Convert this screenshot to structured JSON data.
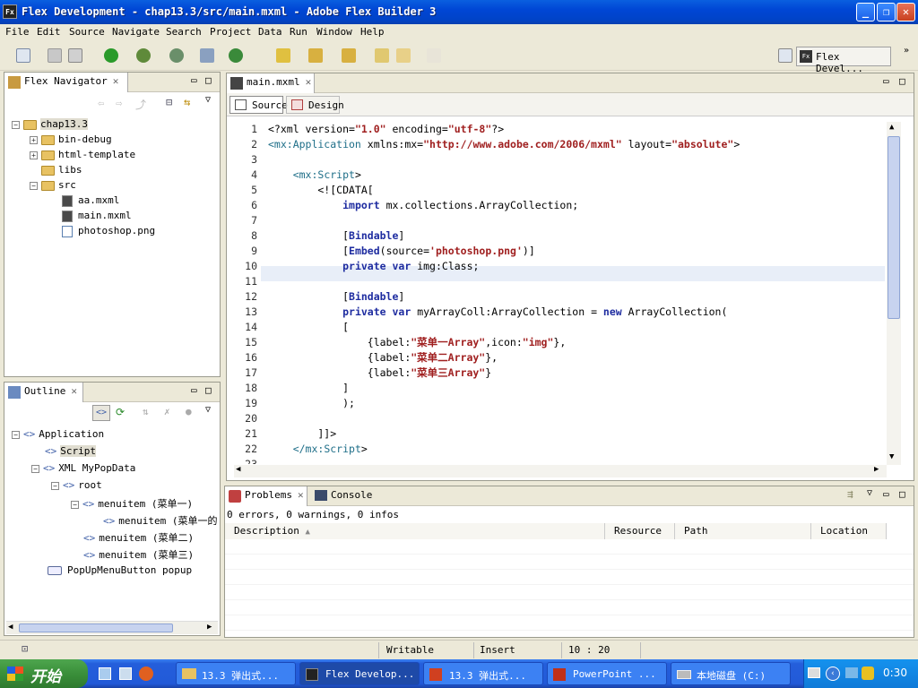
{
  "window": {
    "title": "Flex Development - chap13.3/src/main.mxml - Adobe Flex Builder 3",
    "app_icon": "Fx"
  },
  "menu": [
    "File",
    "Edit",
    "Source",
    "Navigate",
    "Search",
    "Project",
    "Data",
    "Run",
    "Window",
    "Help"
  ],
  "perspective": {
    "label": "Flex Devel...",
    "icon": "Fx"
  },
  "navigator": {
    "tab": "Flex Navigator",
    "project": "chap13.3",
    "items": [
      "bin-debug",
      "html-template",
      "libs",
      "src"
    ],
    "src_items": [
      "aa.mxml",
      "main.mxml",
      "photoshop.png"
    ]
  },
  "outline": {
    "tab": "Outline",
    "nodes": [
      "Application",
      "Script",
      "XML MyPopData",
      "root",
      "menuitem (菜单一)",
      "menuitem (菜单一的",
      "menuitem (菜单二)",
      "menuitem (菜单三)",
      "PopUpMenuButton popup"
    ]
  },
  "editor": {
    "tab": "main.mxml",
    "mode_source": "Source",
    "mode_design": "Design",
    "lines": [
      "<?xml version=\"1.0\" encoding=\"utf-8\"?>",
      "<mx:Application xmlns:mx=\"http://www.adobe.com/2006/mxml\" layout=\"absolute\">",
      "",
      "    <mx:Script>",
      "        <![CDATA[",
      "            import mx.collections.ArrayCollection;",
      "",
      "            [Bindable]",
      "            [Embed(source='photoshop.png')]",
      "            private var img:Class;",
      "",
      "            [Bindable]",
      "            private var myArrayColl:ArrayCollection = new ArrayCollection(",
      "            [",
      "                {label:\"菜单一Array\",icon:\"img\"},",
      "                {label:\"菜单二Array\"},",
      "                {label:\"菜单三Array\"}",
      "            ]",
      "            );",
      "",
      "        ]]>",
      "    </mx:Script>",
      ""
    ]
  },
  "problems": {
    "tab_problems": "Problems",
    "tab_console": "Console",
    "summary": "0 errors, 0 warnings, 0 infos",
    "columns": [
      "Description",
      "Resource",
      "Path",
      "Location"
    ]
  },
  "status": {
    "writable": "Writable",
    "insert": "Insert",
    "position": "10 : 20"
  },
  "taskbar": {
    "start": "开始",
    "tasks": [
      "13.3 弹出式...",
      "Flex Develop...",
      "13.3 弹出式...",
      "PowerPoint ...",
      "本地磁盘 (C:)"
    ],
    "clock": "0:30"
  }
}
